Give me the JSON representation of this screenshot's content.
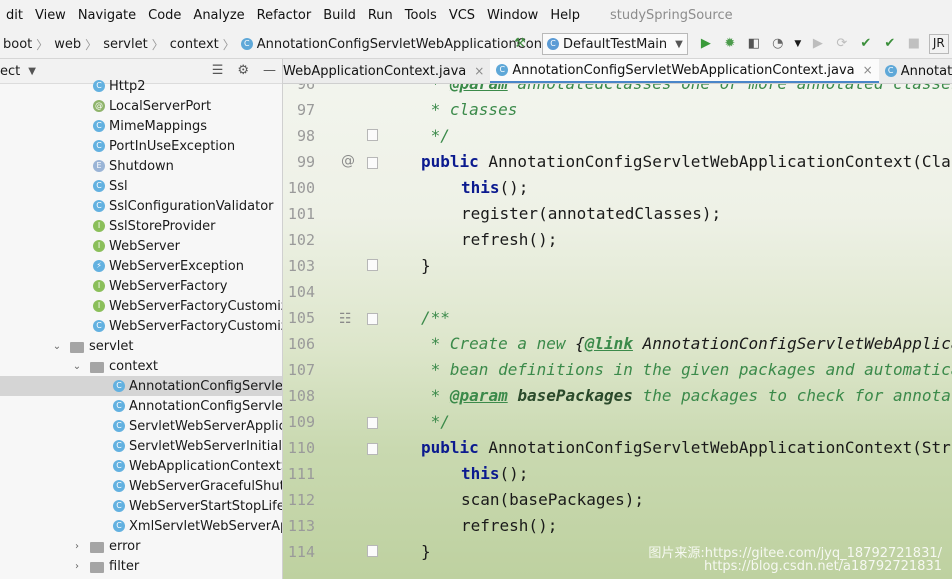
{
  "menu": {
    "items": [
      "dit",
      "View",
      "Navigate",
      "Code",
      "Analyze",
      "Refactor",
      "Build",
      "Run",
      "Tools",
      "VCS",
      "Window",
      "Help"
    ],
    "project_title": "studySpringSource"
  },
  "breadcrumb": {
    "items": [
      "boot",
      "web",
      "servlet",
      "context"
    ],
    "current": "AnnotationConfigServletWebApplicationContext"
  },
  "toolbar": {
    "run_config": "DefaultTestMain",
    "overflow_label": "JR"
  },
  "project_panel": {
    "title": "ect",
    "tree": [
      {
        "label": "Http2",
        "icon": "c"
      },
      {
        "label": "LocalServerPort",
        "icon": "a"
      },
      {
        "label": "MimeMappings",
        "icon": "c"
      },
      {
        "label": "PortInUseException",
        "icon": "c"
      },
      {
        "label": "Shutdown",
        "icon": "e"
      },
      {
        "label": "Ssl",
        "icon": "c"
      },
      {
        "label": "SslConfigurationValidator",
        "icon": "c"
      },
      {
        "label": "SslStoreProvider",
        "icon": "i"
      },
      {
        "label": "WebServer",
        "icon": "i"
      },
      {
        "label": "WebServerException",
        "icon": "c"
      },
      {
        "label": "WebServerFactory",
        "icon": "i"
      },
      {
        "label": "WebServerFactoryCustomizer",
        "icon": "i"
      },
      {
        "label": "WebServerFactoryCustomizerBeanPostProcessor",
        "icon": "c"
      },
      {
        "label": "servlet",
        "icon": "folder"
      },
      {
        "label": "context",
        "icon": "folder"
      },
      {
        "label": "AnnotationConfigServletWebApplicationContext",
        "icon": "c"
      },
      {
        "label": "AnnotationConfigServletWebServerApplicationContext",
        "icon": "c"
      },
      {
        "label": "ServletWebServerApplicationContext",
        "icon": "c"
      },
      {
        "label": "ServletWebServerInitializedEvent",
        "icon": "c"
      },
      {
        "label": "WebApplicationContextServletContextAwareProcessor",
        "icon": "c"
      },
      {
        "label": "WebServerGracefulShutdownLifecycle",
        "icon": "c"
      },
      {
        "label": "WebServerStartStopLifecycle",
        "icon": "c"
      },
      {
        "label": "XmlServletWebServerApplicationContext",
        "icon": "c"
      },
      {
        "label": "error",
        "icon": "folder"
      },
      {
        "label": "filter",
        "icon": "folder"
      }
    ]
  },
  "editor": {
    "tabs": [
      {
        "label": "WebApplicationContext.java",
        "active": false
      },
      {
        "label": "AnnotationConfigServletWebApplicationContext.java",
        "active": true
      },
      {
        "label": "AnnotationConfigRe",
        "active": false
      }
    ],
    "line_numbers": [
      "96",
      "97",
      "98",
      "99",
      "100",
      "101",
      "102",
      "103",
      "104",
      "105",
      "106",
      "107",
      "108",
      "109",
      "110",
      "111",
      "112",
      "113",
      "114"
    ],
    "code": {
      "l96_a": " * ",
      "l96_tag": "@param",
      "l96_b": " annotatedClasses one or more annotated classes",
      "l97": " * classes",
      "l98": " */",
      "l99_kw": "public",
      "l99_b": " AnnotationConfigServletWebApplicationContext(Class<?>... annotatedClasses) {",
      "l100_kw": "this",
      "l100_b": "();",
      "l101": "register(annotatedClasses);",
      "l102": "refresh();",
      "l103": "}",
      "l105": "/**",
      "l106_a": " * Create a new ",
      "l106_lb": "{",
      "l106_tag": "@link",
      "l106_b": " AnnotationConfigServletWebApplicationContext}, scanning for",
      "l107": " * bean definitions in the given packages and automatically refreshing the",
      "l108_a": " * ",
      "l108_tag": "@param",
      "l108_arg": " basePackages",
      "l108_b": " the packages to check for annotated classes",
      "l109": " */",
      "l110_kw": "public",
      "l110_b": " AnnotationConfigServletWebApplicationContext(String... basePackages) {",
      "l111_kw": "this",
      "l111_b": "();",
      "l112": "scan(basePackages);",
      "l113": "refresh();",
      "l114": "}"
    },
    "watermark1": "图片来源:https://gitee.com/jyq_18792721831/",
    "watermark2": "https://blog.csdn.net/a18792721831"
  }
}
